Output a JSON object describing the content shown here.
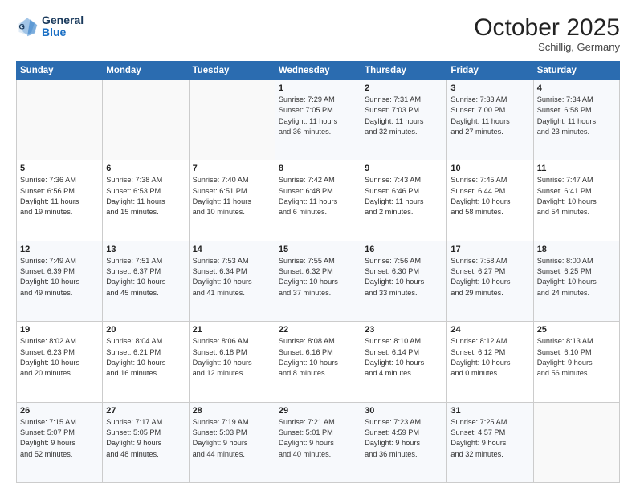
{
  "header": {
    "logo_line1": "General",
    "logo_line2": "Blue",
    "month": "October 2025",
    "location": "Schillig, Germany"
  },
  "weekdays": [
    "Sunday",
    "Monday",
    "Tuesday",
    "Wednesday",
    "Thursday",
    "Friday",
    "Saturday"
  ],
  "weeks": [
    [
      {
        "day": "",
        "info": ""
      },
      {
        "day": "",
        "info": ""
      },
      {
        "day": "",
        "info": ""
      },
      {
        "day": "1",
        "info": "Sunrise: 7:29 AM\nSunset: 7:05 PM\nDaylight: 11 hours\nand 36 minutes."
      },
      {
        "day": "2",
        "info": "Sunrise: 7:31 AM\nSunset: 7:03 PM\nDaylight: 11 hours\nand 32 minutes."
      },
      {
        "day": "3",
        "info": "Sunrise: 7:33 AM\nSunset: 7:00 PM\nDaylight: 11 hours\nand 27 minutes."
      },
      {
        "day": "4",
        "info": "Sunrise: 7:34 AM\nSunset: 6:58 PM\nDaylight: 11 hours\nand 23 minutes."
      }
    ],
    [
      {
        "day": "5",
        "info": "Sunrise: 7:36 AM\nSunset: 6:56 PM\nDaylight: 11 hours\nand 19 minutes."
      },
      {
        "day": "6",
        "info": "Sunrise: 7:38 AM\nSunset: 6:53 PM\nDaylight: 11 hours\nand 15 minutes."
      },
      {
        "day": "7",
        "info": "Sunrise: 7:40 AM\nSunset: 6:51 PM\nDaylight: 11 hours\nand 10 minutes."
      },
      {
        "day": "8",
        "info": "Sunrise: 7:42 AM\nSunset: 6:48 PM\nDaylight: 11 hours\nand 6 minutes."
      },
      {
        "day": "9",
        "info": "Sunrise: 7:43 AM\nSunset: 6:46 PM\nDaylight: 11 hours\nand 2 minutes."
      },
      {
        "day": "10",
        "info": "Sunrise: 7:45 AM\nSunset: 6:44 PM\nDaylight: 10 hours\nand 58 minutes."
      },
      {
        "day": "11",
        "info": "Sunrise: 7:47 AM\nSunset: 6:41 PM\nDaylight: 10 hours\nand 54 minutes."
      }
    ],
    [
      {
        "day": "12",
        "info": "Sunrise: 7:49 AM\nSunset: 6:39 PM\nDaylight: 10 hours\nand 49 minutes."
      },
      {
        "day": "13",
        "info": "Sunrise: 7:51 AM\nSunset: 6:37 PM\nDaylight: 10 hours\nand 45 minutes."
      },
      {
        "day": "14",
        "info": "Sunrise: 7:53 AM\nSunset: 6:34 PM\nDaylight: 10 hours\nand 41 minutes."
      },
      {
        "day": "15",
        "info": "Sunrise: 7:55 AM\nSunset: 6:32 PM\nDaylight: 10 hours\nand 37 minutes."
      },
      {
        "day": "16",
        "info": "Sunrise: 7:56 AM\nSunset: 6:30 PM\nDaylight: 10 hours\nand 33 minutes."
      },
      {
        "day": "17",
        "info": "Sunrise: 7:58 AM\nSunset: 6:27 PM\nDaylight: 10 hours\nand 29 minutes."
      },
      {
        "day": "18",
        "info": "Sunrise: 8:00 AM\nSunset: 6:25 PM\nDaylight: 10 hours\nand 24 minutes."
      }
    ],
    [
      {
        "day": "19",
        "info": "Sunrise: 8:02 AM\nSunset: 6:23 PM\nDaylight: 10 hours\nand 20 minutes."
      },
      {
        "day": "20",
        "info": "Sunrise: 8:04 AM\nSunset: 6:21 PM\nDaylight: 10 hours\nand 16 minutes."
      },
      {
        "day": "21",
        "info": "Sunrise: 8:06 AM\nSunset: 6:18 PM\nDaylight: 10 hours\nand 12 minutes."
      },
      {
        "day": "22",
        "info": "Sunrise: 8:08 AM\nSunset: 6:16 PM\nDaylight: 10 hours\nand 8 minutes."
      },
      {
        "day": "23",
        "info": "Sunrise: 8:10 AM\nSunset: 6:14 PM\nDaylight: 10 hours\nand 4 minutes."
      },
      {
        "day": "24",
        "info": "Sunrise: 8:12 AM\nSunset: 6:12 PM\nDaylight: 10 hours\nand 0 minutes."
      },
      {
        "day": "25",
        "info": "Sunrise: 8:13 AM\nSunset: 6:10 PM\nDaylight: 9 hours\nand 56 minutes."
      }
    ],
    [
      {
        "day": "26",
        "info": "Sunrise: 7:15 AM\nSunset: 5:07 PM\nDaylight: 9 hours\nand 52 minutes."
      },
      {
        "day": "27",
        "info": "Sunrise: 7:17 AM\nSunset: 5:05 PM\nDaylight: 9 hours\nand 48 minutes."
      },
      {
        "day": "28",
        "info": "Sunrise: 7:19 AM\nSunset: 5:03 PM\nDaylight: 9 hours\nand 44 minutes."
      },
      {
        "day": "29",
        "info": "Sunrise: 7:21 AM\nSunset: 5:01 PM\nDaylight: 9 hours\nand 40 minutes."
      },
      {
        "day": "30",
        "info": "Sunrise: 7:23 AM\nSunset: 4:59 PM\nDaylight: 9 hours\nand 36 minutes."
      },
      {
        "day": "31",
        "info": "Sunrise: 7:25 AM\nSunset: 4:57 PM\nDaylight: 9 hours\nand 32 minutes."
      },
      {
        "day": "",
        "info": ""
      }
    ]
  ]
}
